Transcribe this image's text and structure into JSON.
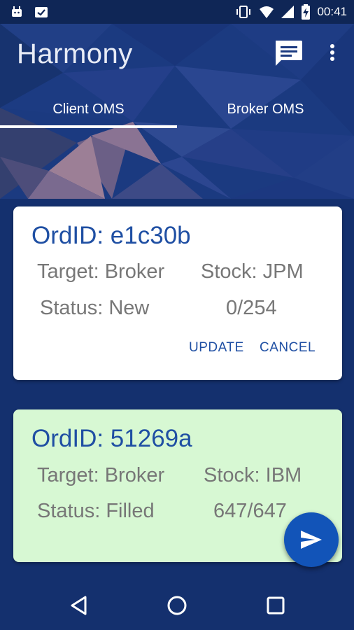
{
  "status_bar": {
    "time": "00:41",
    "icons": [
      "android-icon",
      "clipboard-check-icon",
      "vibrate-icon",
      "wifi-icon",
      "signal-icon",
      "battery-charging-icon"
    ]
  },
  "app_bar": {
    "title": "Harmony",
    "actions": [
      "chat-icon",
      "more-vert-icon"
    ]
  },
  "tabs": [
    {
      "label": "Client OMS",
      "selected": true
    },
    {
      "label": "Broker OMS",
      "selected": false
    }
  ],
  "orders": [
    {
      "ordid": "OrdID: e1c30b",
      "target": "Target: Broker",
      "stock": "Stock: JPM",
      "status": "Status: New",
      "fill": "0/254",
      "actions": {
        "update": "UPDATE",
        "cancel": "CANCEL"
      },
      "background": "#ffffff"
    },
    {
      "ordid": "OrdID: 51269a",
      "target": "Target: Broker",
      "stock": "Stock: IBM",
      "status": "Status: Filled",
      "fill": "647/647",
      "background": "#d7f8d3"
    }
  ],
  "fab": {
    "icon": "send-icon"
  },
  "nav_bar": {
    "icons": [
      "back-icon",
      "home-icon",
      "recents-icon"
    ]
  },
  "colors": {
    "primary_dark": "#14306e",
    "accent": "#1254b8",
    "order_id_text": "#1f4fa3",
    "filled_card": "#d7f8d3"
  }
}
